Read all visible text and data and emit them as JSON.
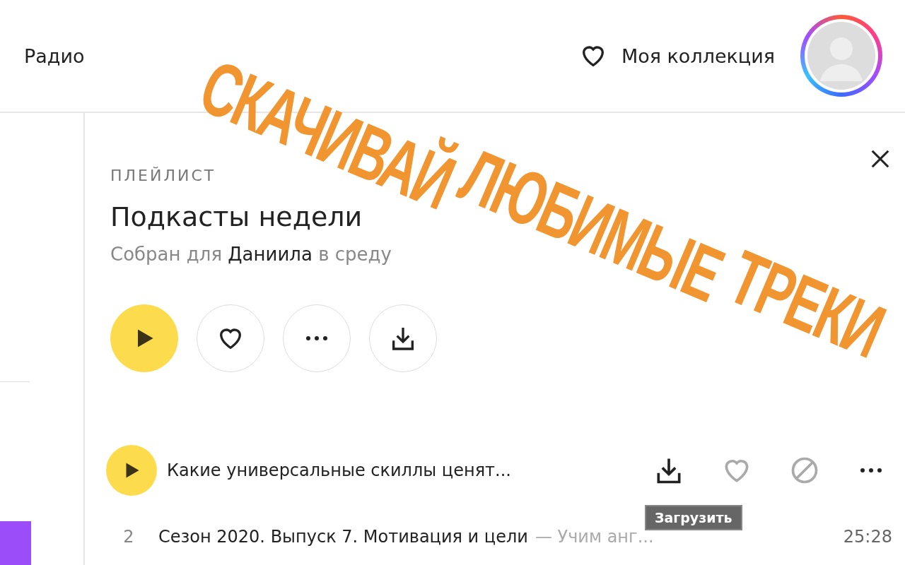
{
  "header": {
    "nav_item": "Радио",
    "collection_link": "Моя коллекция"
  },
  "playlist": {
    "kicker": "ПЛЕЙЛИСТ",
    "title": "Подкасты недели",
    "subtitle": "Собран для **Даниила** в среду"
  },
  "tracks": [
    {
      "kind": "playing",
      "title": "Какие универсальные скиллы ценят...",
      "tooltip": "Загрузить"
    },
    {
      "kind": "numbered",
      "number": "2",
      "title": "Сезон 2020. Выпуск 7. Мотивация и цели",
      "artist": "— Учим анг...",
      "duration": "25:28"
    }
  ],
  "overlay_caption": [
    "СКАЧИВАЙ",
    "ЛЮБИМЫЕ",
    "ТРЕКИ"
  ]
}
